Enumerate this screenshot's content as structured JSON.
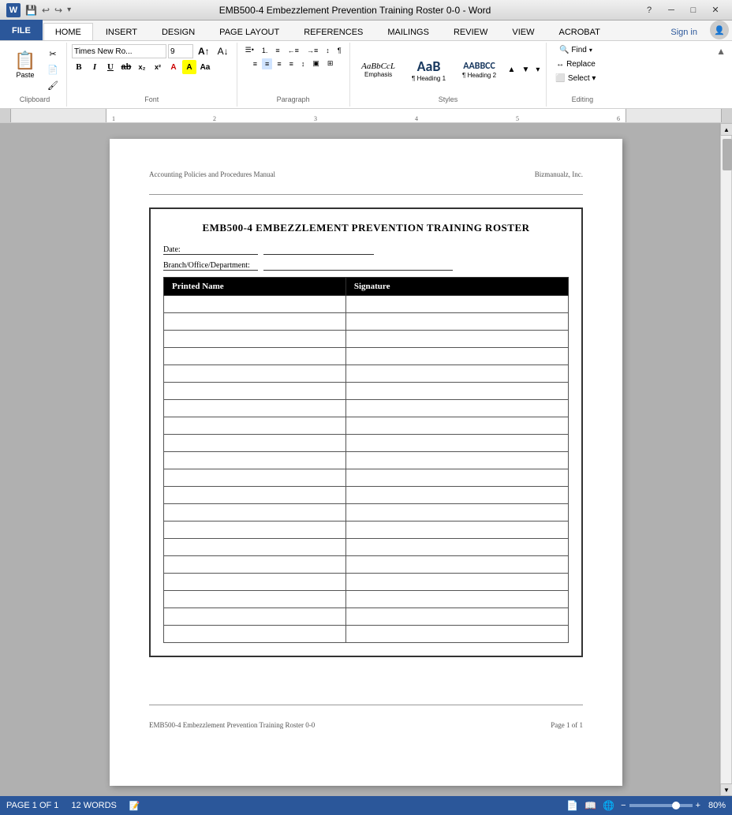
{
  "titlebar": {
    "title": "EMB500-4 Embezzlement Prevention Training Roster 0-0 - Word",
    "help_btn": "?",
    "minimize_btn": "─",
    "maximize_btn": "□",
    "close_btn": "✕"
  },
  "ribbon": {
    "tabs": [
      {
        "label": "FILE",
        "key": "file",
        "active": false
      },
      {
        "label": "HOME",
        "key": "home",
        "active": true
      },
      {
        "label": "INSERT",
        "key": "insert",
        "active": false
      },
      {
        "label": "DESIGN",
        "key": "design",
        "active": false
      },
      {
        "label": "PAGE LAYOUT",
        "key": "page_layout",
        "active": false
      },
      {
        "label": "REFERENCES",
        "key": "references",
        "active": false
      },
      {
        "label": "MAILINGS",
        "key": "mailings",
        "active": false
      },
      {
        "label": "REVIEW",
        "key": "review",
        "active": false
      },
      {
        "label": "VIEW",
        "key": "view",
        "active": false
      },
      {
        "label": "ACROBAT",
        "key": "acrobat",
        "active": false
      }
    ],
    "sign_in": "Sign in",
    "groups": {
      "clipboard": {
        "label": "Clipboard",
        "paste_label": "Paste"
      },
      "font": {
        "label": "Font",
        "font_name": "Times New Ro...",
        "font_size": "9",
        "bold": "B",
        "italic": "I",
        "underline": "U"
      },
      "paragraph": {
        "label": "Paragraph"
      },
      "styles": {
        "label": "Styles",
        "items": [
          {
            "name": "Emphasis",
            "preview": "AaBbCcL"
          },
          {
            "name": "Heading 1",
            "preview": "AaB",
            "size": "large"
          },
          {
            "name": "Heading 2",
            "preview": "AABBCC"
          }
        ]
      },
      "editing": {
        "label": "Editing",
        "find_label": "Find",
        "replace_label": "Replace",
        "select_label": "Select ▾"
      }
    }
  },
  "document": {
    "page_header_left": "Accounting Policies and Procedures Manual",
    "page_header_right": "Bizmanualz, Inc.",
    "title": "EMB500-4 EMBEZZLEMENT PREVENTION TRAINING ROSTER",
    "date_label": "Date:",
    "date_line": "____________________",
    "branch_label": "Branch/Office/Department:",
    "branch_line": "___________________________",
    "table": {
      "col1_header": "Printed Name",
      "col2_header": "Signature",
      "rows": 20
    },
    "page_footer_left": "EMB500-4 Embezzlement Prevention Training Roster 0-0",
    "page_footer_right": "Page 1 of 1"
  },
  "statusbar": {
    "page_info": "PAGE 1 OF 1",
    "words": "12 WORDS",
    "zoom_level": "80%"
  }
}
